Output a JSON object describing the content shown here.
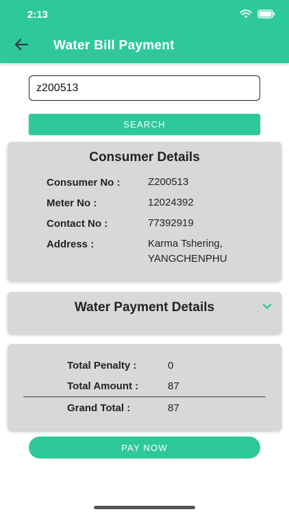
{
  "status_bar": {
    "time": "2:13"
  },
  "header": {
    "title": "Water Bill Payment"
  },
  "search": {
    "value": "z200513",
    "button_label": "SEARCH"
  },
  "consumer": {
    "title": "Consumer Details",
    "rows": [
      {
        "label": "Consumer No :",
        "value": "Z200513"
      },
      {
        "label": "Meter No :",
        "value": "12024392"
      },
      {
        "label": "Contact No :",
        "value": "77392919"
      },
      {
        "label": "Address :",
        "value_line1": "Karma Tshering,",
        "value_line2": "YANGCHENPHU"
      }
    ]
  },
  "payment_details": {
    "title": "Water Payment Details"
  },
  "totals": {
    "penalty_label": "Total Penalty :",
    "penalty_value": "0",
    "amount_label": "Total Amount :",
    "amount_value": "87",
    "grand_label": "Grand Total :",
    "grand_value": "87"
  },
  "pay_button": {
    "label": "PAY NOW"
  },
  "colors": {
    "accent": "#2ec99a",
    "card": "#d8d8d8"
  }
}
